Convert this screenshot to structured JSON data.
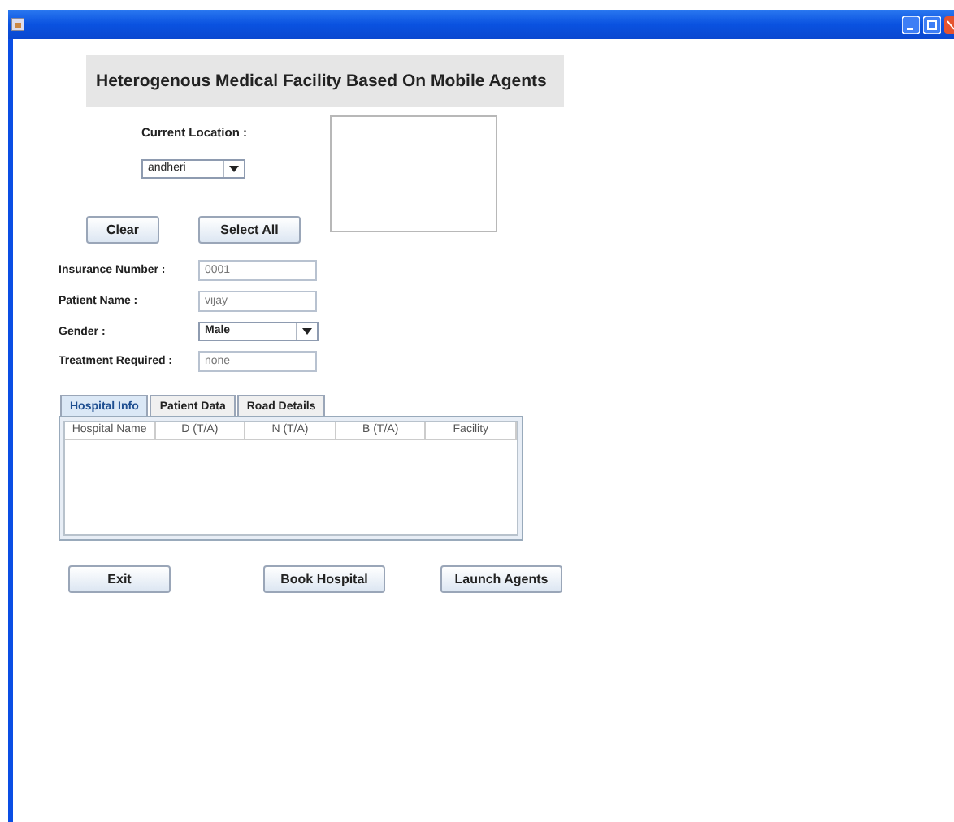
{
  "heading": "Heterogenous Medical Facility Based On Mobile Agents",
  "location": {
    "label": "Current Location :",
    "value": "andheri"
  },
  "top_buttons": [
    "Clear",
    "Select All"
  ],
  "fields": [
    {
      "kind": "text",
      "label": "Insurance Number :",
      "value": "0001"
    },
    {
      "kind": "text",
      "label": "Patient Name :",
      "value": "vijay"
    },
    {
      "kind": "combo",
      "label": "Gender :",
      "value": "Male"
    },
    {
      "kind": "text",
      "label": "Treatment Required :",
      "value": "none"
    }
  ],
  "tabs": [
    {
      "label": "Hospital Info",
      "selected": true
    },
    {
      "label": "Patient Data",
      "selected": false
    },
    {
      "label": "Road Details",
      "selected": false
    }
  ],
  "table": {
    "columns": [
      "Hospital Name",
      "D (T/A)",
      "N (T/A)",
      "B (T/A)",
      "Facility"
    ]
  },
  "bottom_buttons": [
    "Exit",
    "Book Hospital",
    "Launch Agents"
  ]
}
